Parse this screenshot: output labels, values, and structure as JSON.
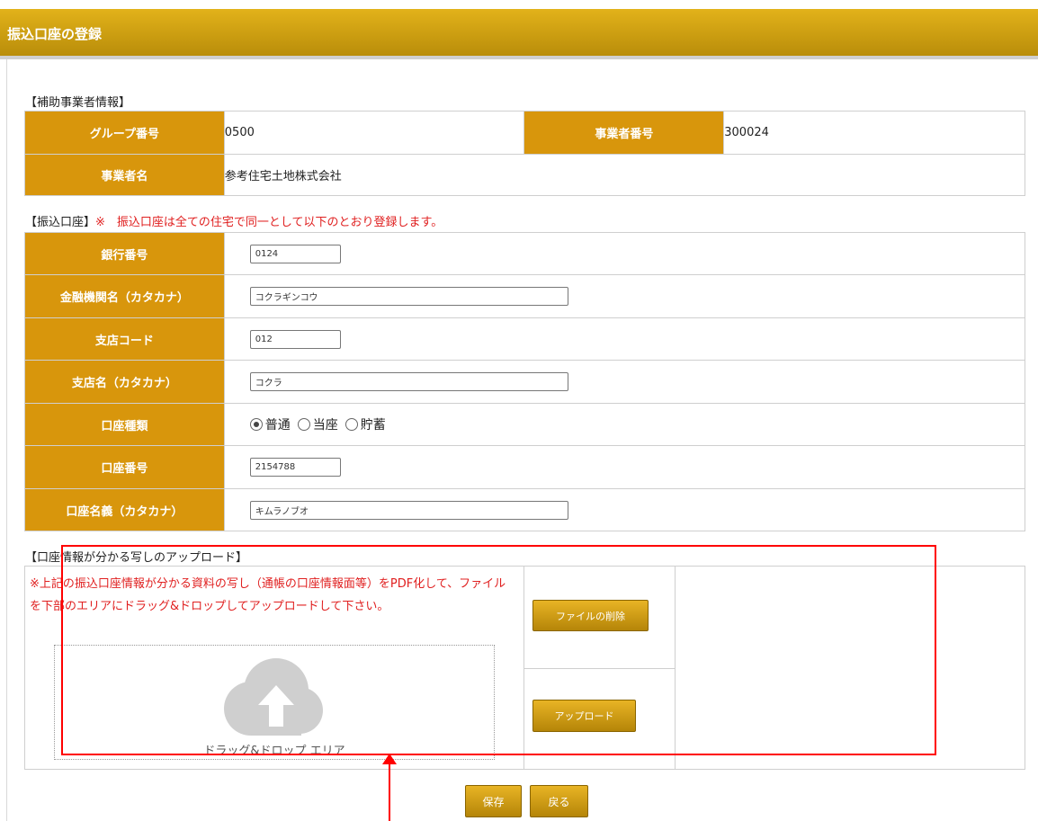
{
  "header": {
    "title": "振込口座の登録"
  },
  "business_section": {
    "label": "【補助事業者情報】",
    "group_number_label": "グループ番号",
    "group_number_value": "0500",
    "business_number_label": "事業者番号",
    "business_number_value": "300024",
    "business_name_label": "事業者名",
    "business_name_value": "参考住宅土地株式会社"
  },
  "account_section": {
    "label": "【振込口座】",
    "note": "※　振込口座は全ての住宅で同一として以下のとおり登録します。",
    "bank_code_label": "銀行番号",
    "bank_code_value": "0124",
    "bank_name_label": "金融機関名（カタカナ）",
    "bank_name_value": "コクラギンコウ",
    "branch_code_label": "支店コード",
    "branch_code_value": "012",
    "branch_name_label": "支店名（カタカナ）",
    "branch_name_value": "コクラ",
    "account_type_label": "口座種類",
    "account_type_options": [
      "普通",
      "当座",
      "貯蓄"
    ],
    "account_type_selected": "普通",
    "account_number_label": "口座番号",
    "account_number_value": "2154788",
    "account_holder_label": "口座名義（カタカナ）",
    "account_holder_value": "キムラノブオ"
  },
  "upload_section": {
    "label": "【口座情報が分かる写しのアップロード】",
    "note": "※上記の振込口座情報が分かる資料の写し（通帳の口座情報面等）をPDF化して、ファイルを下部のエリアにドラッグ&ドロップしてアップロードして下さい。",
    "drop_area_label": "ドラッグ&ドロップ エリア",
    "delete_button": "ファイルの削除",
    "upload_button": "アップロード"
  },
  "footer": {
    "save_button": "保存",
    "back_button": "戻る"
  },
  "colors": {
    "header_gold": "#c99a0f",
    "cell_gold": "#d8960c",
    "warning_red": "#e02020",
    "annotation_red": "#ff0000"
  },
  "icons": {
    "cloud": "cloud-upload-icon"
  }
}
